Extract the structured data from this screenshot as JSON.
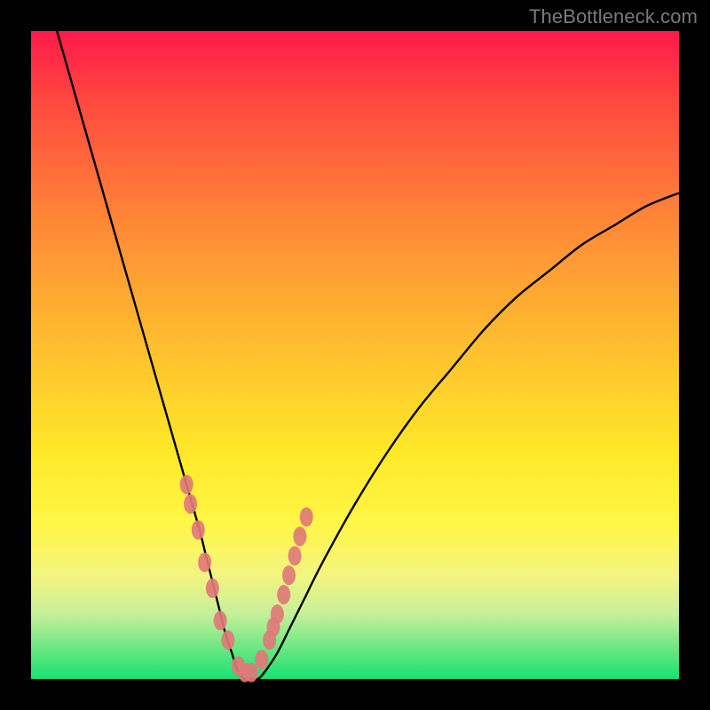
{
  "watermark": "TheBottleneck.com",
  "chart_data": {
    "type": "line",
    "title": "",
    "xlabel": "",
    "ylabel": "",
    "xlim": [
      0,
      100
    ],
    "ylim": [
      0,
      100
    ],
    "grid": false,
    "legend": false,
    "series": [
      {
        "name": "bottleneck-curve",
        "color": "#000000",
        "x": [
          4,
          6,
          8,
          10,
          12,
          14,
          16,
          18,
          20,
          22,
          24,
          26,
          27,
          28,
          29,
          30,
          31,
          32,
          33,
          34,
          35,
          36,
          38,
          40,
          42,
          45,
          50,
          55,
          60,
          65,
          70,
          75,
          80,
          85,
          90,
          95,
          100
        ],
        "y": [
          100,
          93,
          86,
          79,
          72,
          65,
          58,
          51,
          44,
          37,
          30,
          23,
          19,
          15,
          11,
          7,
          4,
          1,
          0,
          0,
          0,
          1,
          4,
          8,
          12,
          18,
          27,
          35,
          42,
          48,
          54,
          59,
          63,
          67,
          70,
          73,
          75
        ]
      },
      {
        "name": "dotted-markers",
        "color": "#e07a78",
        "style": "scatter",
        "x": [
          24.0,
          24.6,
          25.8,
          26.8,
          28.0,
          29.2,
          30.4,
          32.0,
          33.0,
          34.0,
          35.6,
          36.8,
          37.4,
          38.0,
          39.0,
          39.8,
          40.7,
          41.5,
          42.5
        ],
        "y": [
          30,
          27,
          23,
          18,
          14,
          9,
          6,
          2,
          1,
          1,
          3,
          6,
          8,
          10,
          13,
          16,
          19,
          22,
          25
        ]
      }
    ],
    "background_gradient": {
      "type": "vertical",
      "stops": [
        {
          "pos": 0.0,
          "color": "#ff194a"
        },
        {
          "pos": 0.1,
          "color": "#ff4540"
        },
        {
          "pos": 0.22,
          "color": "#ff6f3a"
        },
        {
          "pos": 0.35,
          "color": "#ff9934"
        },
        {
          "pos": 0.5,
          "color": "#ffc22e"
        },
        {
          "pos": 0.65,
          "color": "#ffe828"
        },
        {
          "pos": 0.76,
          "color": "#fff646"
        },
        {
          "pos": 0.84,
          "color": "#f4f480"
        },
        {
          "pos": 0.9,
          "color": "#c6f09a"
        },
        {
          "pos": 0.95,
          "color": "#70e884"
        },
        {
          "pos": 1.0,
          "color": "#18e170"
        }
      ]
    }
  }
}
